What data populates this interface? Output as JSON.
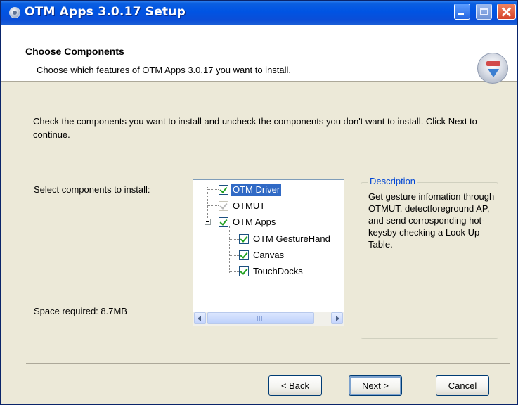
{
  "window": {
    "title": "OTM Apps 3.0.17 Setup"
  },
  "header": {
    "title": "Choose Components",
    "subtitle": "Choose which features of OTM Apps 3.0.17 you want to install."
  },
  "body": {
    "instructions": "Check the components you want to install and uncheck the components you don't want to install. Click Next to continue.",
    "select_label": "Select components to install:",
    "space_required": "Space required: 8.7MB"
  },
  "tree": {
    "items": [
      {
        "label": "OTM Driver",
        "checked": true,
        "selected": true,
        "disabled": false
      },
      {
        "label": "OTMUT",
        "checked": true,
        "selected": false,
        "disabled": true
      },
      {
        "label": "OTM Apps",
        "checked": true,
        "selected": false,
        "disabled": false
      },
      {
        "label": "OTM GestureHand",
        "checked": true,
        "selected": false,
        "disabled": false
      },
      {
        "label": "Canvas",
        "checked": true,
        "selected": false,
        "disabled": false
      },
      {
        "label": "TouchDocks",
        "checked": true,
        "selected": false,
        "disabled": false
      }
    ]
  },
  "description": {
    "legend": "Description",
    "text": "Get gesture infomation through OTMUT, detectforeground AP, and send corrosponding hot-keysby checking a Look Up Table."
  },
  "buttons": {
    "back": "< Back",
    "next": "Next >",
    "cancel": "Cancel"
  },
  "icons": {
    "title_icon": "installer-disc-icon",
    "header_icon": "install-package-icon"
  },
  "colors": {
    "titlebar": "#0054e3",
    "selection": "#316ac5",
    "legend": "#0046d5",
    "dialog_bg": "#ece9d8"
  }
}
